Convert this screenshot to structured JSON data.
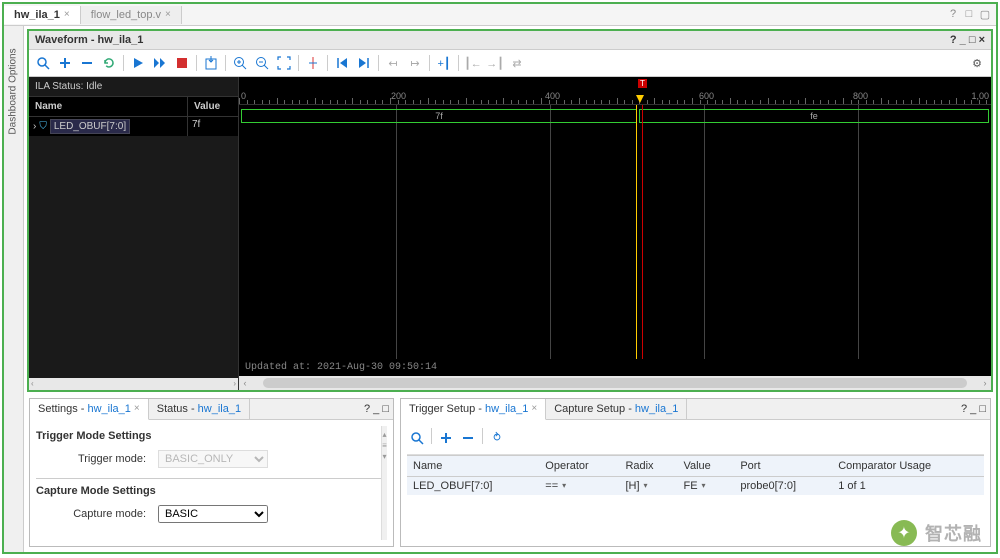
{
  "top_tabs": {
    "active": "hw_ila_1",
    "inactive": "flow_led_top.v"
  },
  "sidebar_label": "Dashboard Options",
  "waveform": {
    "title": "Waveform - hw_ila_1",
    "ila_status": "ILA Status: Idle",
    "cols": {
      "name": "Name",
      "value": "Value"
    },
    "signal": {
      "name": "LED_OBUF[7:0]",
      "value": "7f"
    },
    "footer": "Updated at: 2021-Aug-30 09:50:14",
    "ruler_labels": [
      "0",
      "200",
      "400",
      "600",
      "800",
      "1,00"
    ],
    "bus_values": [
      "7f",
      "fe"
    ]
  },
  "settings": {
    "tab1_prefix": "Settings - ",
    "tab1_link": "hw_ila_1",
    "tab2_prefix": "Status - ",
    "tab2_link": "hw_ila_1",
    "trigger_section": "Trigger Mode Settings",
    "trigger_label": "Trigger mode:",
    "trigger_value": "BASIC_ONLY",
    "capture_section": "Capture Mode Settings",
    "capture_label": "Capture mode:",
    "capture_value": "BASIC"
  },
  "trigger_panel": {
    "tab1_prefix": "Trigger Setup - ",
    "tab1_link": "hw_ila_1",
    "tab2_prefix": "Capture Setup - ",
    "tab2_link": "hw_ila_1",
    "headers": [
      "Name",
      "Operator",
      "Radix",
      "Value",
      "Port",
      "Comparator Usage"
    ],
    "row": {
      "name": "LED_OBUF[7:0]",
      "operator": "==",
      "radix": "[H]",
      "value": "FE",
      "port": "probe0[7:0]",
      "usage": "1 of 1"
    }
  },
  "watermark": "智芯融"
}
